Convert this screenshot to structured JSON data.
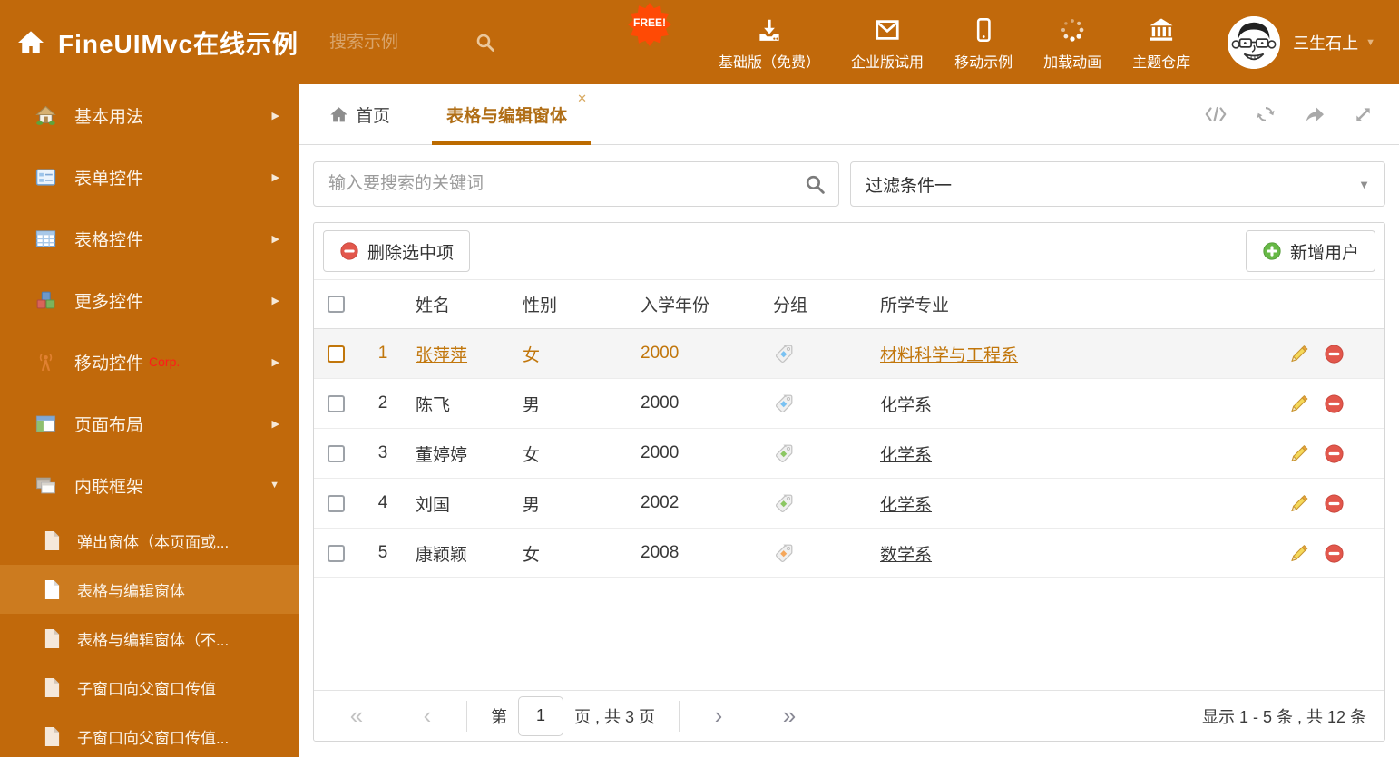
{
  "header": {
    "title": "FineUIMvc在线示例",
    "search_placeholder": "搜索示例",
    "free_badge": "FREE!",
    "menu": [
      {
        "label": "基础版（免费）",
        "icon": "download-icon"
      },
      {
        "label": "企业版试用",
        "icon": "envelope-icon"
      },
      {
        "label": "移动示例",
        "icon": "mobile-icon"
      },
      {
        "label": "加载动画",
        "icon": "spinner-icon"
      },
      {
        "label": "主题仓库",
        "icon": "bank-icon"
      }
    ],
    "user": {
      "name": "三生石上",
      "caret": "▼"
    }
  },
  "sidebar": {
    "items": [
      {
        "label": "基本用法",
        "icon": "home-icon",
        "arrow": "▶"
      },
      {
        "label": "表单控件",
        "icon": "form-icon",
        "arrow": "▶"
      },
      {
        "label": "表格控件",
        "icon": "table-icon",
        "arrow": "▶"
      },
      {
        "label": "更多控件",
        "icon": "cubes-icon",
        "arrow": "▶"
      },
      {
        "label": "移动控件",
        "badge": "Corp.",
        "icon": "antenna-icon",
        "arrow": "▶"
      },
      {
        "label": "页面布局",
        "icon": "layout-icon",
        "arrow": "▶"
      },
      {
        "label": "内联框架",
        "icon": "frames-icon",
        "arrow": "▼"
      }
    ],
    "subitems": [
      {
        "label": "弹出窗体（本页面或..."
      },
      {
        "label": "表格与编辑窗体",
        "selected": true
      },
      {
        "label": "表格与编辑窗体（不..."
      },
      {
        "label": "子窗口向父窗口传值"
      },
      {
        "label": "子窗口向父窗口传值..."
      }
    ]
  },
  "tabs": {
    "home": {
      "label": "首页"
    },
    "active": {
      "label": "表格与编辑窗体",
      "close": "✕"
    }
  },
  "filters": {
    "search_placeholder": "输入要搜索的关键词",
    "filter_value": "过滤条件一",
    "caret": "▼"
  },
  "toolbar": {
    "delete_label": "删除选中项",
    "add_label": "新增用户"
  },
  "table": {
    "columns": {
      "name": "姓名",
      "gender": "性别",
      "year": "入学年份",
      "group": "分组",
      "major": "所学专业"
    },
    "rows": [
      {
        "num": "1",
        "name": "张萍萍",
        "gender": "女",
        "year": "2000",
        "tag": "blue",
        "major": "材料科学与工程系",
        "selected": true
      },
      {
        "num": "2",
        "name": "陈飞",
        "gender": "男",
        "year": "2000",
        "tag": "blue",
        "major": "化学系"
      },
      {
        "num": "3",
        "name": "董婷婷",
        "gender": "女",
        "year": "2000",
        "tag": "green",
        "major": "化学系"
      },
      {
        "num": "4",
        "name": "刘国",
        "gender": "男",
        "year": "2002",
        "tag": "green",
        "major": "化学系"
      },
      {
        "num": "5",
        "name": "康颖颖",
        "gender": "女",
        "year": "2008",
        "tag": "orange",
        "major": "数学系"
      }
    ]
  },
  "pagination": {
    "first": "«",
    "prev": "‹",
    "next": "›",
    "last": "»",
    "page_prefix": "第",
    "page_value": "1",
    "page_suffix": "页 , 共 3 页",
    "summary": "显示 1 - 5 条 , 共 12 条"
  },
  "colors": {
    "brand_orange": "#C1690B",
    "sidebar_selected": "#CC7B1F",
    "tab_active": "#B06E16",
    "selected_row_text": "#C1760B",
    "danger": "#E2574C",
    "success": "#67B946",
    "free_badge": "#FF4A05",
    "tag_blue": "#79C1F2",
    "tag_green": "#8CC763",
    "tag_orange": "#F5A75B"
  }
}
